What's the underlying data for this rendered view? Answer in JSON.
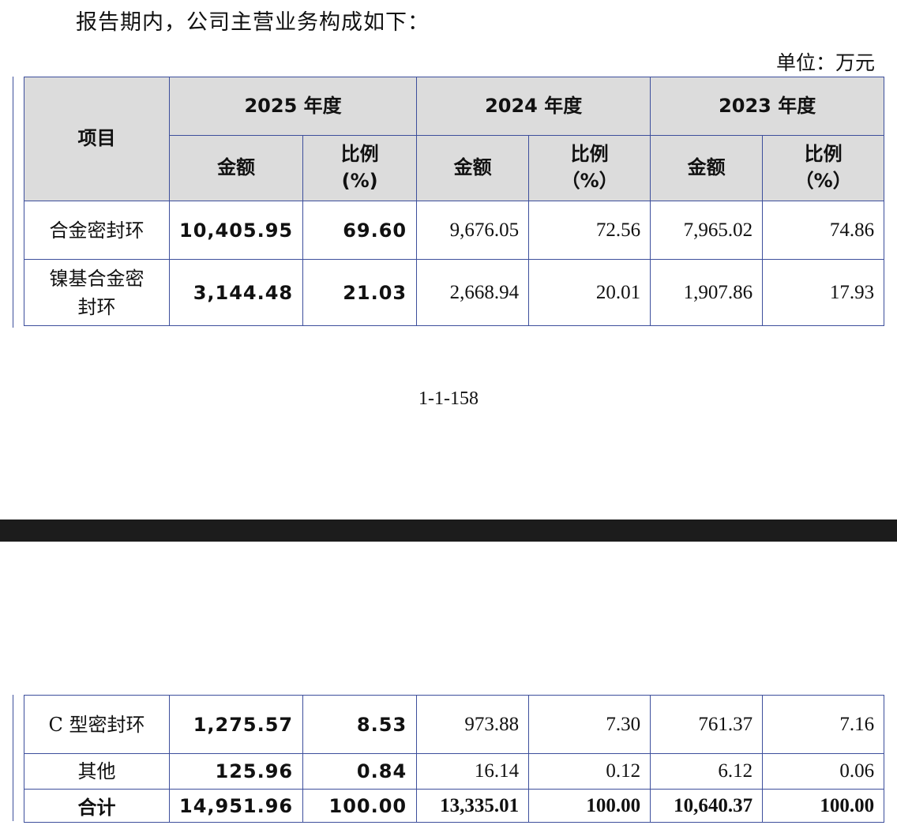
{
  "intro_text": "报告期内，公司主营业务构成如下：",
  "unit_text": "单位：万元",
  "page_number": "1-1-158",
  "header": {
    "item": "项目",
    "years": [
      "2025 年度",
      "2024 年度",
      "2023 年度"
    ],
    "amount": "金额",
    "ratio_2025": "比例\n(%)",
    "ratio": "比例\n（%）"
  },
  "rows_top": [
    {
      "item": "合金密封环",
      "v2025": "10,405.95",
      "r2025": "69.60",
      "v2024": "9,676.05",
      "r2024": "72.56",
      "v2023": "7,965.02",
      "r2023": "74.86"
    },
    {
      "item": "镍基合金密\n封环",
      "v2025": "3,144.48",
      "r2025": "21.03",
      "v2024": "2,668.94",
      "r2024": "20.01",
      "v2023": "1,907.86",
      "r2023": "17.93"
    }
  ],
  "rows_bottom": [
    {
      "item": "C 型密封环",
      "v2025": "1,275.57",
      "r2025": "8.53",
      "v2024": "973.88",
      "r2024": "7.30",
      "v2023": "761.37",
      "r2023": "7.16"
    },
    {
      "item": "其他",
      "v2025": "125.96",
      "r2025": "0.84",
      "v2024": "16.14",
      "r2024": "0.12",
      "v2023": "6.12",
      "r2023": "0.06"
    }
  ],
  "total": {
    "item": "合计",
    "v2025": "14,951.96",
    "r2025": "100.00",
    "v2024": "13,335.01",
    "r2024": "100.00",
    "v2023": "10,640.37",
    "r2023": "100.00"
  }
}
